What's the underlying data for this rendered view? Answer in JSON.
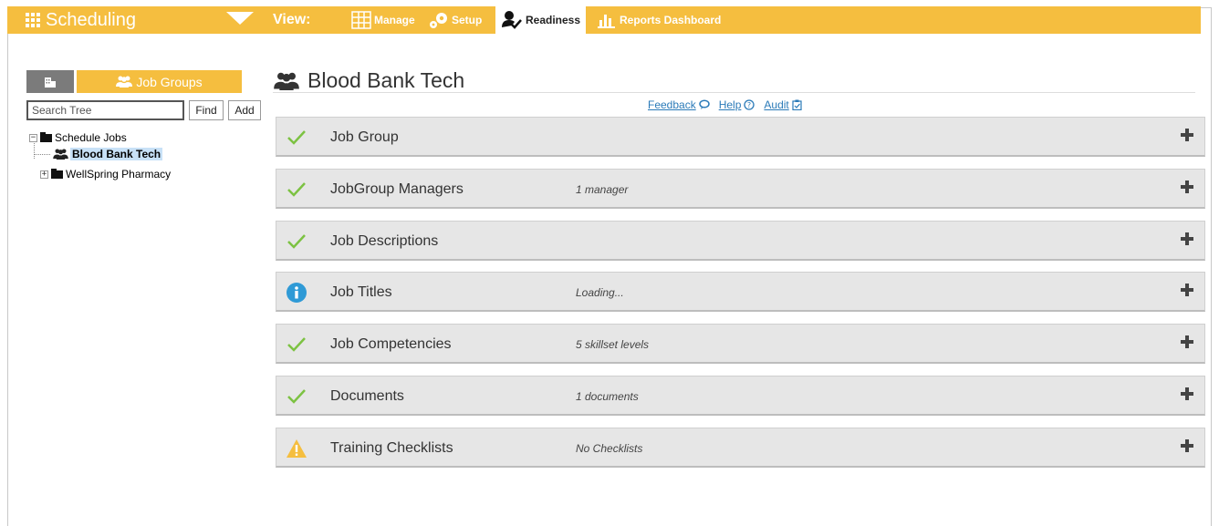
{
  "header": {
    "app_title": "Scheduling",
    "view_label": "View:",
    "tabs": [
      {
        "label": "Manage",
        "icon": "grid-table-icon"
      },
      {
        "label": "Setup",
        "icon": "gears-icon"
      },
      {
        "label": "Readiness",
        "icon": "user-check-icon",
        "active": true
      },
      {
        "label": "Reports Dashboard",
        "icon": "bar-chart-icon"
      }
    ],
    "accent_color": "#f5be3f"
  },
  "sidebar": {
    "job_groups_label": "Job Groups",
    "search": {
      "placeholder": "Search Tree",
      "value": ""
    },
    "find_label": "Find",
    "add_label": "Add",
    "tree": {
      "root": "Schedule Jobs",
      "selected": "Blood Bank Tech",
      "sibling": "WellSpring Pharmacy"
    }
  },
  "main": {
    "title": "Blood Bank Tech",
    "links": {
      "feedback": "Feedback",
      "help": "Help",
      "audit": "Audit"
    },
    "panels": [
      {
        "label": "Job Group",
        "summary": "",
        "status": "check"
      },
      {
        "label": "JobGroup Managers",
        "summary": "1 manager",
        "status": "check"
      },
      {
        "label": "Job Descriptions",
        "summary": "",
        "status": "check"
      },
      {
        "label": "Job Titles",
        "summary": "Loading...",
        "status": "info"
      },
      {
        "label": "Job Competencies",
        "summary": "5 skillset levels",
        "status": "check"
      },
      {
        "label": "Documents",
        "summary": "1 documents",
        "status": "check"
      },
      {
        "label": "Training Checklists",
        "summary": "No Checklists",
        "status": "warning"
      }
    ],
    "status_colors": {
      "check": "#7cc242",
      "info": "#2f9ad6",
      "warning": "#f5be3f"
    }
  }
}
